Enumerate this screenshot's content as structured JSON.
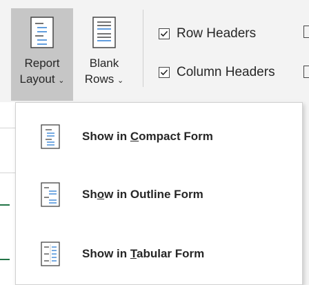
{
  "ribbon": {
    "report_layout": {
      "line1": "Report",
      "line2": "Layout"
    },
    "blank_rows": {
      "line1": "Blank",
      "line2": "Rows"
    },
    "checkboxes": [
      {
        "label": "Row Headers",
        "checked": true
      },
      {
        "label": "Column Headers",
        "checked": true
      }
    ]
  },
  "menu": {
    "items": [
      {
        "pre": "Show in ",
        "accel": "C",
        "post": "ompact Form",
        "icon": "compact-form-icon"
      },
      {
        "pre": "Sh",
        "accel": "o",
        "post": "w in Outline Form",
        "icon": "outline-form-icon"
      },
      {
        "pre": "Show in ",
        "accel": "T",
        "post": "abular Form",
        "icon": "tabular-form-icon"
      }
    ]
  },
  "colors": {
    "accent_blue": "#2b7cd3",
    "excel_green": "#217346",
    "pressed_bg": "#c6c6c6"
  }
}
